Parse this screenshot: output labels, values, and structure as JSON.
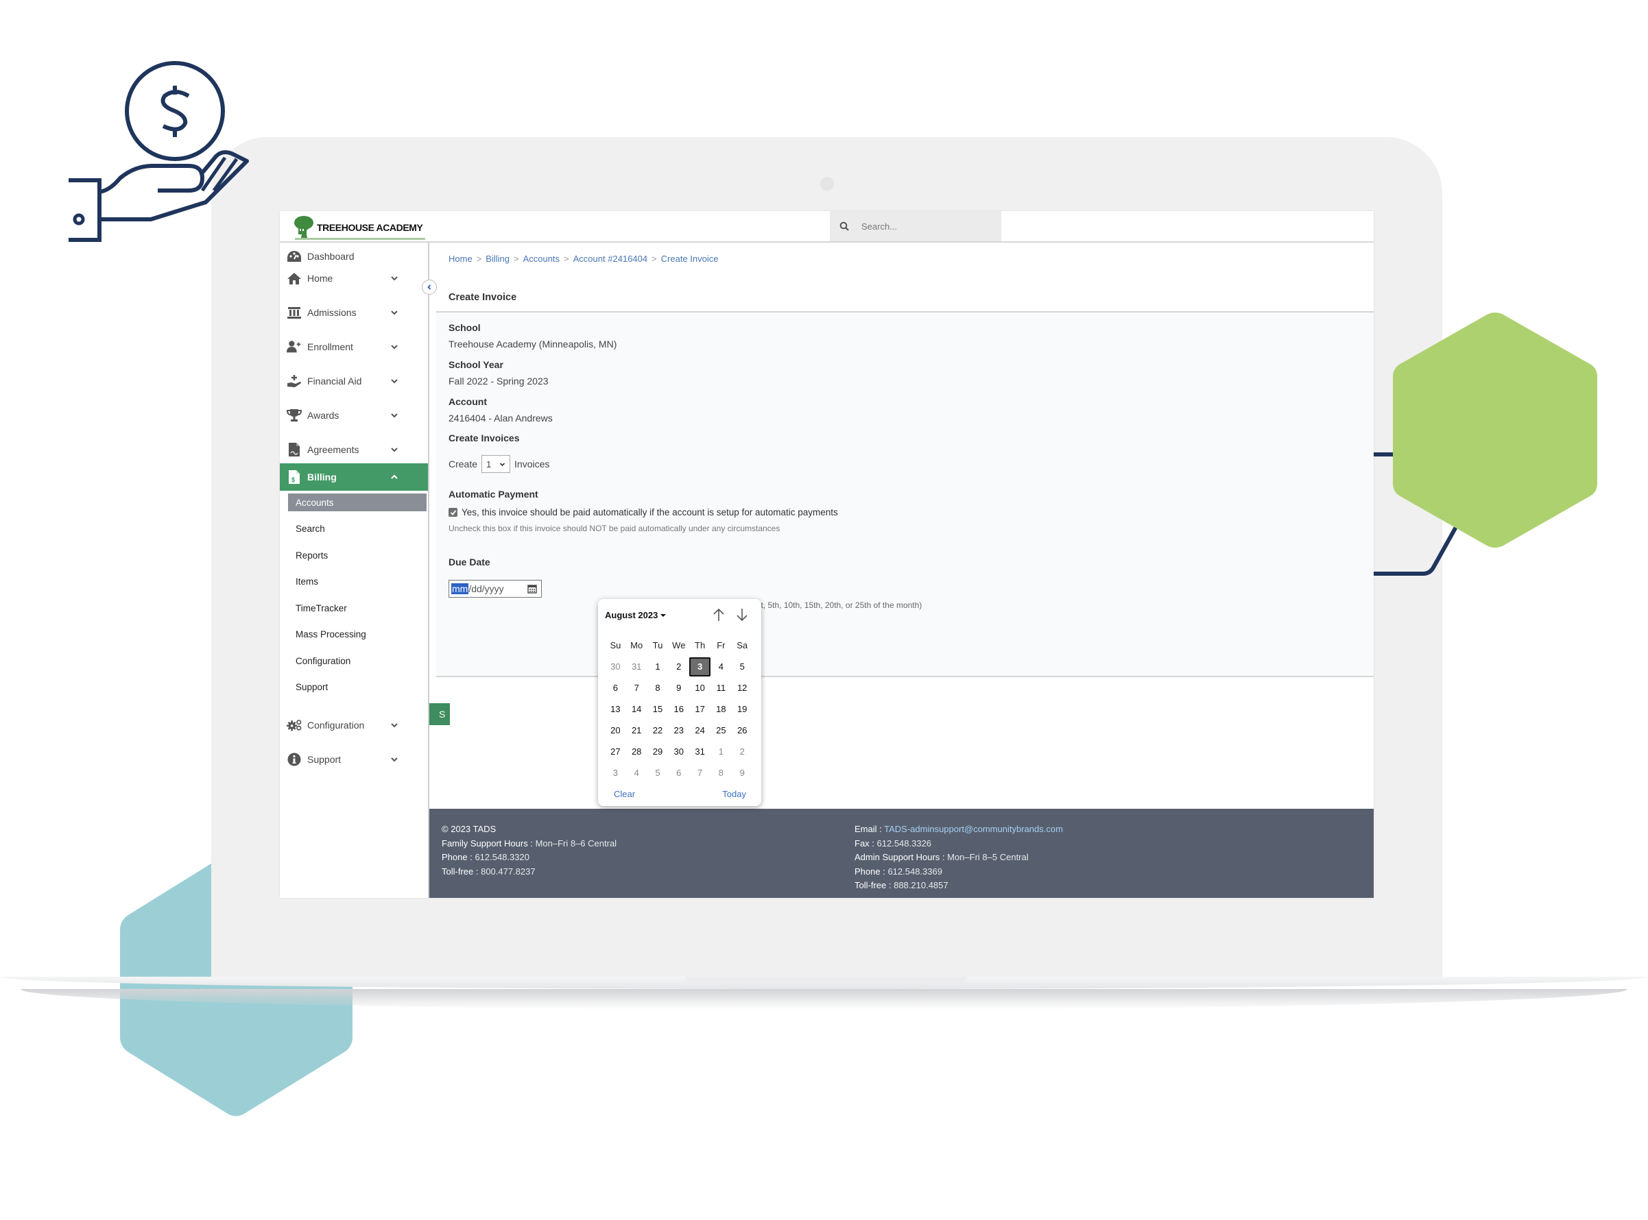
{
  "app": {
    "brand": "TREEHOUSE ACADEMY",
    "search_placeholder": "Search..."
  },
  "colors": {
    "brand_green": "#439a67",
    "link_blue": "#4a77b6",
    "footer_bg": "#575f6e",
    "decor_green": "#aed170",
    "decor_teal": "#9ccfd5",
    "decor_navy": "#1f355c"
  },
  "sidebar": {
    "items": [
      {
        "label": "Dashboard",
        "icon": "dashboard-icon",
        "expandable": false
      },
      {
        "label": "Home",
        "icon": "home-icon",
        "expandable": true
      },
      {
        "label": "Admissions",
        "icon": "bank-icon",
        "expandable": true
      },
      {
        "label": "Enrollment",
        "icon": "user-plus-icon",
        "expandable": true
      },
      {
        "label": "Financial Aid",
        "icon": "hand-plus-icon",
        "expandable": true
      },
      {
        "label": "Awards",
        "icon": "trophy-icon",
        "expandable": true
      },
      {
        "label": "Agreements",
        "icon": "signed-document-icon",
        "expandable": true
      },
      {
        "label": "Billing",
        "icon": "invoice-icon",
        "expandable": true,
        "expanded": true,
        "active": true
      },
      {
        "label": "Configuration",
        "icon": "gears-icon",
        "expandable": true
      },
      {
        "label": "Support",
        "icon": "info-icon",
        "expandable": true
      }
    ],
    "billing_subitems": [
      {
        "label": "Accounts",
        "selected": true
      },
      {
        "label": "Search"
      },
      {
        "label": "Reports"
      },
      {
        "label": "Items"
      },
      {
        "label": "TimeTracker"
      },
      {
        "label": "Mass Processing"
      },
      {
        "label": "Configuration"
      },
      {
        "label": "Support"
      }
    ]
  },
  "breadcrumb": [
    "Home",
    "Billing",
    "Accounts",
    "Account #2416404",
    "Create Invoice"
  ],
  "breadcrumb_separator": ">",
  "page_title": "Create Invoice",
  "form": {
    "school_label": "School",
    "school_value": "Treehouse Academy (Minneapolis, MN)",
    "year_label": "School Year",
    "year_value": "Fall 2022 - Spring 2023",
    "account_label": "Account",
    "account_value": "2416404 - Alan Andrews",
    "create_invoices_label": "Create Invoices",
    "create_prefix": "Create",
    "create_count": "1",
    "create_suffix": "Invoices",
    "auto_payment_label": "Automatic Payment",
    "auto_payment_checked": true,
    "auto_payment_text": "Yes, this invoice should be paid automatically if the account is setup for automatic payments",
    "auto_payment_hint": "Uncheck this box if this invoice should NOT be paid automatically under any circumstances",
    "due_date_label": "Due Date",
    "due_date_mm": "mm",
    "due_date_rest": "/dd/yyyy",
    "due_date_hint": "10 days in the future and fall on the 1st, 5th, 10th, 15th, 20th, or 25th of the month)",
    "submit_label_visible": "S"
  },
  "datepicker": {
    "month_label": "August 2023",
    "weekdays": [
      "Su",
      "Mo",
      "Tu",
      "We",
      "Th",
      "Fr",
      "Sa"
    ],
    "weeks": [
      [
        {
          "d": "30",
          "o": true
        },
        {
          "d": "31",
          "o": true
        },
        {
          "d": "1"
        },
        {
          "d": "2"
        },
        {
          "d": "3",
          "s": true
        },
        {
          "d": "4"
        },
        {
          "d": "5"
        }
      ],
      [
        {
          "d": "6"
        },
        {
          "d": "7"
        },
        {
          "d": "8"
        },
        {
          "d": "9"
        },
        {
          "d": "10"
        },
        {
          "d": "11"
        },
        {
          "d": "12"
        }
      ],
      [
        {
          "d": "13"
        },
        {
          "d": "14"
        },
        {
          "d": "15"
        },
        {
          "d": "16"
        },
        {
          "d": "17"
        },
        {
          "d": "18"
        },
        {
          "d": "19"
        }
      ],
      [
        {
          "d": "20"
        },
        {
          "d": "21"
        },
        {
          "d": "22"
        },
        {
          "d": "23"
        },
        {
          "d": "24"
        },
        {
          "d": "25"
        },
        {
          "d": "26"
        }
      ],
      [
        {
          "d": "27"
        },
        {
          "d": "28"
        },
        {
          "d": "29"
        },
        {
          "d": "30"
        },
        {
          "d": "31"
        },
        {
          "d": "1",
          "o": true
        },
        {
          "d": "2",
          "o": true
        }
      ],
      [
        {
          "d": "3",
          "o": true
        },
        {
          "d": "4",
          "o": true
        },
        {
          "d": "5",
          "o": true
        },
        {
          "d": "6",
          "o": true
        },
        {
          "d": "7",
          "o": true
        },
        {
          "d": "8",
          "o": true
        },
        {
          "d": "9",
          "o": true
        }
      ]
    ],
    "selected_day": "3",
    "clear_label": "Clear",
    "today_label": "Today"
  },
  "footer": {
    "copyright": "© 2023 TADS",
    "left": [
      {
        "k": "Family Support Hours",
        "v": "Mon–Fri 8–6 Central"
      },
      {
        "k": "Phone",
        "v": "612.548.3320"
      },
      {
        "k": "Toll-free",
        "v": "800.477.8237"
      }
    ],
    "right": [
      {
        "k": "Email",
        "v": "TADS-adminsupport@communitybrands.com",
        "link": true
      },
      {
        "k": "Fax",
        "v": "612.548.3326"
      },
      {
        "k": "Admin Support Hours",
        "v": "Mon–Fri 8–5 Central"
      },
      {
        "k": "Phone",
        "v": "612.548.3369"
      },
      {
        "k": "Toll-free",
        "v": "888.210.4857"
      }
    ]
  }
}
